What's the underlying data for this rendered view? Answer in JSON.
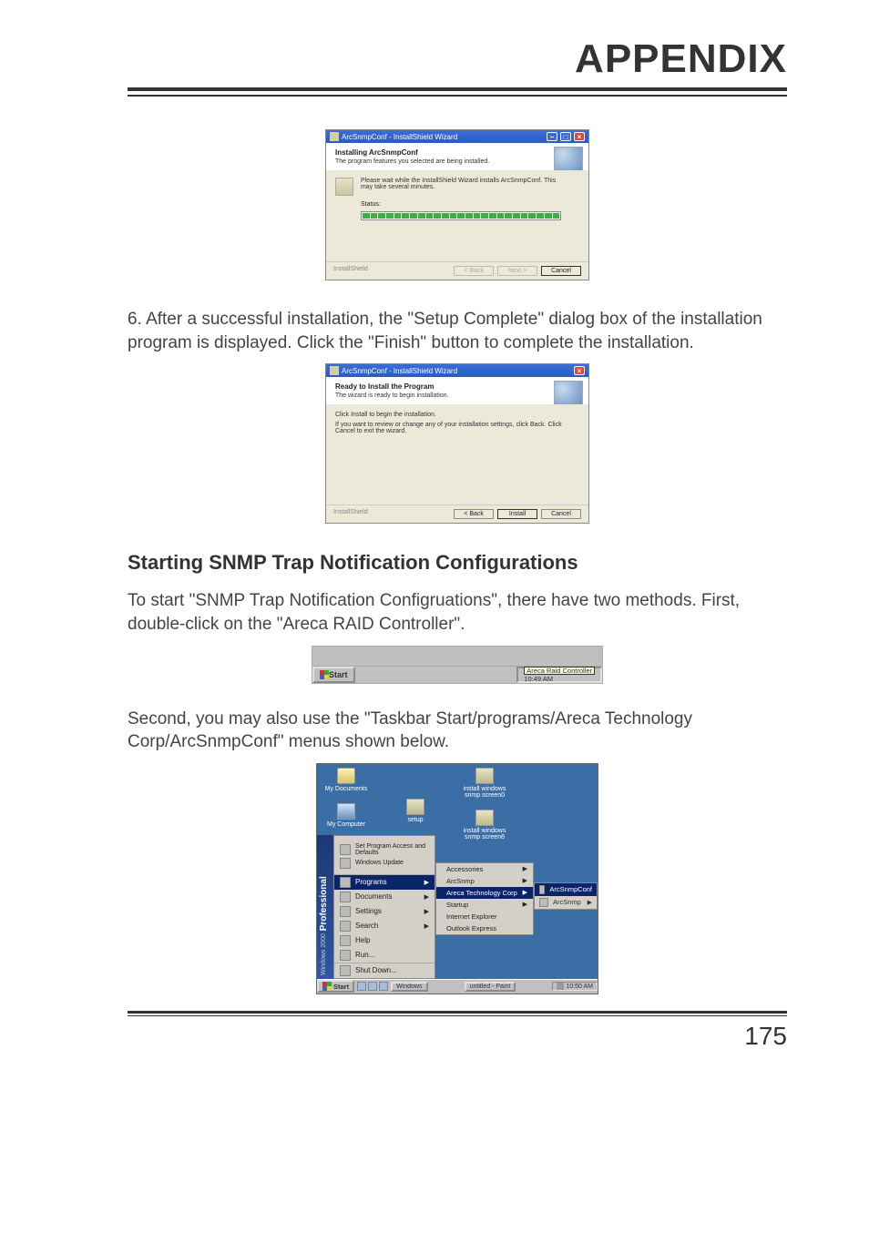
{
  "header": {
    "title": "APPENDIX"
  },
  "dialog1": {
    "window_title": "ArcSnmpConf - InstallShield Wizard",
    "head_title": "Installing ArcSnmpConf",
    "head_sub": "The program features you selected are being installed.",
    "body_text": "Please wait while the InstallShield Wizard installs ArcSnmpConf. This may take several minutes.",
    "status_label": "Status:",
    "brand": "InstallShield",
    "btn_back": "< Back",
    "btn_next": "Next >",
    "btn_cancel": "Cancel"
  },
  "para1": "6. After a successful installation, the \"Setup Complete\" dialog box of the installation program is displayed. Click the \"Finish\" button to complete the installation.",
  "dialog2": {
    "window_title": "ArcSnmpConf - InstallShield Wizard",
    "head_title": "Ready to Install the Program",
    "head_sub": "The wizard is ready to begin installation.",
    "body_l1": "Click Install to begin the installation.",
    "body_l2": "If you want to review or change any of your installation settings, click Back. Click Cancel to exit the wizard.",
    "brand": "InstallShield",
    "btn_back": "< Back",
    "btn_install": "Install",
    "btn_cancel": "Cancel"
  },
  "section_heading": "Starting SNMP Trap Notification Configurations",
  "para2": "To start \"SNMP Trap Notification Configruations\", there have two methods. First, double-click on the \"Areca RAID Controller\".",
  "taskbar_strip": {
    "start": "Start",
    "tray_top": "Areca Raid Controller",
    "tray_bottom": "10:49 AM"
  },
  "para3": "Second, you may also use the \"Taskbar Start/programs/Areca Technology Corp/ArcSnmpConf\" menus shown below.",
  "startmenu": {
    "desktop_icons": {
      "my_documents": "My Documents",
      "my_computer": "My Computer",
      "setup": "setup",
      "install1": "install windows snmp screen0",
      "install2": "install windows snmp screen6"
    },
    "sidebar_pro": "Professional",
    "sidebar_ver": "Windows 2000",
    "top": {
      "set_access": "Set Program Access and Defaults",
      "win_update": "Windows Update"
    },
    "main": {
      "programs": "Programs",
      "documents": "Documents",
      "settings": "Settings",
      "search": "Search",
      "help": "Help",
      "run": "Run...",
      "shutdown": "Shut Down..."
    },
    "sub1": {
      "accessories": "Accessories",
      "arcsnmp": "ArcSnmp",
      "areca": "Areca Technology Corp",
      "startup": "Startup",
      "ie": "Internet Explorer",
      "outlook": "Outlook Express"
    },
    "sub2": {
      "arcsnmpconf": "ArcSnmpConf",
      "arcsnmp": "ArcSnmp"
    },
    "taskbar": {
      "start": "Start",
      "task1": "Windows",
      "task2": "untitled - Paint",
      "clock": "10:50 AM"
    }
  },
  "page_number": "175"
}
